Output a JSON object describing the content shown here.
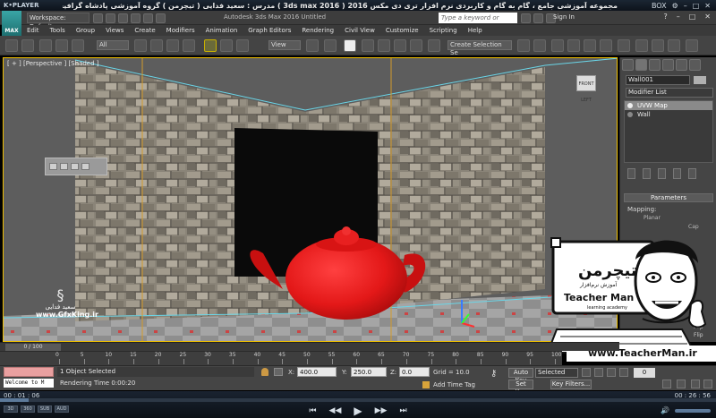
{
  "player": {
    "logo": "K•PLAYER",
    "title": "مجموعه آموزشی جامع ، گام به گام و کاربردی نرم افزار تری دی مکس 2016  ( 3ds max 2016 )  مدرس : سعید فدایی ( تیچرمن ) گروه آموزشی پادشاه گرافیست ها",
    "controls": [
      "BOX",
      "⚙",
      "–",
      "□",
      "✕"
    ],
    "time_elapsed": "00 : 01 : 06",
    "time_total": "00 : 26 : 56",
    "progress": 0.04,
    "mode_buttons": [
      "3D",
      "360",
      "SUB",
      "AUD"
    ],
    "playback": [
      "⏮",
      "◀◀",
      "▶",
      "▶▶",
      "⏭"
    ],
    "volume_icon": "🔊"
  },
  "max": {
    "logo": "MAX",
    "workspace": "Workspace: Default",
    "title": "Autodesk 3ds Max 2016    Untitled",
    "search_placeholder": "Type a keyword or phrase",
    "sign_in": "Sign In",
    "window_controls": [
      "?",
      "–",
      "□",
      "✕"
    ]
  },
  "menu": [
    "Edit",
    "Tools",
    "Group",
    "Views",
    "Create",
    "Modifiers",
    "Animation",
    "Graph Editors",
    "Rendering",
    "Civil View",
    "Customize",
    "Scripting",
    "Help"
  ],
  "toolbar": {
    "filter": "All",
    "view": "View",
    "selection_set": "Create Selection Se"
  },
  "viewport": {
    "label": "[ + ] [Perspective ] [Shaded ]",
    "viewcube_label": "FRONT LEFT",
    "wall_color": "#8a8478",
    "teapot_color": "#e31818",
    "floor_color": "#9a9a9a"
  },
  "watermark": {
    "name": "سعید فدایی",
    "site": "www.GfxKing.ir"
  },
  "command_panel": {
    "object_name": "Wall001",
    "modifier_list": "Modifier List",
    "stack": [
      {
        "label": "UVW Map",
        "selected": true
      },
      {
        "label": "Wall",
        "selected": false
      }
    ],
    "parameters_label": "Parameters",
    "mapping_label": "Mapping:",
    "planar_label": "Planar",
    "cap_label": "Cap",
    "flip_labels": [
      "Flip",
      "Flip",
      "Flip"
    ]
  },
  "teacher": {
    "persian_name": "تیچرمن",
    "subtitle": "آموزش نرم‌افزار",
    "english_name": "Teacher Man",
    "tagline": "learning academy",
    "url": "www.TeacherMan.ir"
  },
  "timeline": {
    "frame": "0 / 100",
    "ticks": [
      "0",
      "5",
      "10",
      "15",
      "20",
      "25",
      "30",
      "35",
      "40",
      "45",
      "50",
      "55",
      "60",
      "65",
      "70",
      "75",
      "80",
      "85",
      "90",
      "95",
      "100"
    ]
  },
  "status": {
    "listener": "Welcome to M",
    "message": "1 Object Selected",
    "render_time": "Rendering Time  0:00:20",
    "x_label": "X:",
    "x_value": "400.0",
    "y_label": "Y:",
    "y_value": "250.0",
    "z_label": "Z:",
    "z_value": "0.0",
    "grid": "Grid = 10.0",
    "add_time_tag": "Add Time Tag",
    "auto_key": "Auto Key",
    "set_key": "Set Key",
    "selected": "Selected",
    "key_filters": "Key Filters...",
    "current_frame": "0"
  }
}
